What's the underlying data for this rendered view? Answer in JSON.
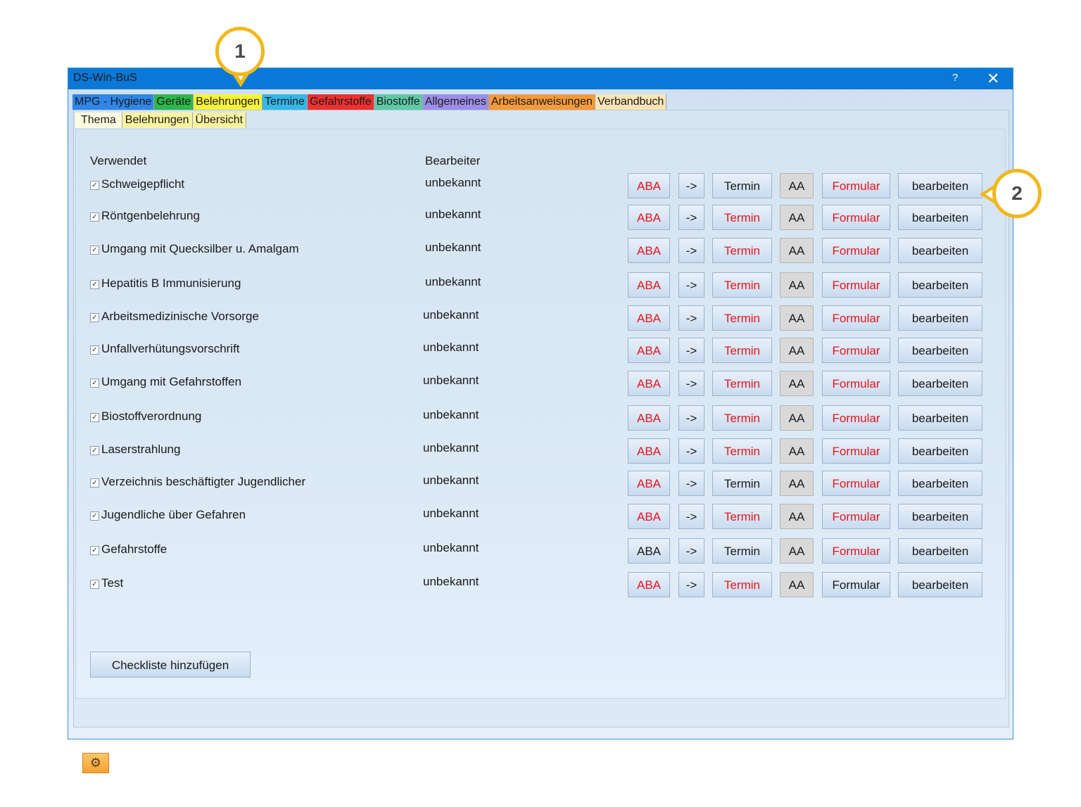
{
  "window": {
    "title": "DS-Win-BuS",
    "help": "?",
    "close": "✕"
  },
  "main_tabs": [
    {
      "label": "MPG - Hygiene",
      "color": "#2f86e6"
    },
    {
      "label": "Geräte",
      "color": "#2db84b"
    },
    {
      "label": "Belehrungen",
      "color": "#f7f23a"
    },
    {
      "label": "Termine",
      "color": "#35b7e8"
    },
    {
      "label": "Gefahrstoffe",
      "color": "#ee3030"
    },
    {
      "label": "Biostoffe",
      "color": "#5fc9a6"
    },
    {
      "label": "Allgemeines",
      "color": "#9b8ee8"
    },
    {
      "label": "Arbeitsanweisungen",
      "color": "#f59a3a"
    },
    {
      "label": "Verbandbuch",
      "color": "#f8e5b5"
    }
  ],
  "sub_tabs": [
    "Thema",
    "Belehrungen",
    "Übersicht"
  ],
  "headers": {
    "verwendet": "Verwendet",
    "bearbeiter": "Bearbeiter"
  },
  "checkmark": "✓",
  "rows": [
    {
      "name": "Schweigepflicht",
      "bearbeiter": "unbekannt",
      "aba": "red",
      "termin": "black",
      "formular": "red"
    },
    {
      "name": "Röntgenbelehrung",
      "bearbeiter": "unbekannt",
      "aba": "red",
      "termin": "red",
      "formular": "red"
    },
    {
      "name": "Umgang mit Quecksilber u. Amalgam",
      "bearbeiter": "unbekannt",
      "aba": "red",
      "termin": "red",
      "formular": "red"
    },
    {
      "name": "Hepatitis B Immunisierung",
      "bearbeiter": "unbekannt",
      "aba": "red",
      "termin": "red",
      "formular": "red"
    },
    {
      "name": "Arbeitsmedizinische Vorsorge",
      "bearbeiter": "unbekannt",
      "aba": "red",
      "termin": "red",
      "formular": "red"
    },
    {
      "name": "Unfallverhütungsvorschrift",
      "bearbeiter": "unbekannt",
      "aba": "red",
      "termin": "red",
      "formular": "red"
    },
    {
      "name": "Umgang mit Gefahrstoffen",
      "bearbeiter": "unbekannt",
      "aba": "red",
      "termin": "red",
      "formular": "red"
    },
    {
      "name": "Biostoffverordnung",
      "bearbeiter": "unbekannt",
      "aba": "red",
      "termin": "red",
      "formular": "red"
    },
    {
      "name": "Laserstrahlung",
      "bearbeiter": "unbekannt",
      "aba": "red",
      "termin": "red",
      "formular": "red"
    },
    {
      "name": "Verzeichnis beschäftigter Jugendlicher",
      "bearbeiter": "unbekannt",
      "aba": "red",
      "termin": "black",
      "formular": "red"
    },
    {
      "name": "Jugendliche über Gefahren",
      "bearbeiter": "unbekannt",
      "aba": "red",
      "termin": "red",
      "formular": "red"
    },
    {
      "name": "Gefahrstoffe",
      "bearbeiter": "unbekannt",
      "aba": "black",
      "termin": "black",
      "formular": "red"
    },
    {
      "name": "Test",
      "bearbeiter": "unbekannt",
      "aba": "red",
      "termin": "red",
      "formular": "black"
    }
  ],
  "row_buttons": {
    "aba": "ABA",
    "arrow": "->",
    "termin": "Termin",
    "aa": "AA",
    "formular": "Formular",
    "bearbeiten": "bearbeiten"
  },
  "add_button": "Checkliste hinzufügen",
  "settings_icon": "gear-icon",
  "callouts": [
    "1",
    "2"
  ],
  "accent": "#f2b71b"
}
